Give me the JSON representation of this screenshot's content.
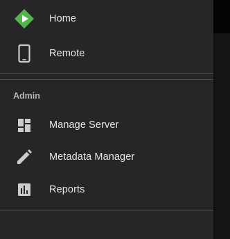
{
  "nav_top": {
    "home": {
      "label": "Home",
      "icon": "home-logo-icon",
      "accent": "#52b54b"
    },
    "remote": {
      "label": "Remote",
      "icon": "tablet-icon"
    }
  },
  "admin_section": {
    "header": "Admin",
    "items": [
      {
        "label": "Manage Server",
        "icon": "dashboard-icon"
      },
      {
        "label": "Metadata Manager",
        "icon": "pencil-icon"
      },
      {
        "label": "Reports",
        "icon": "bar-chart-icon"
      }
    ]
  },
  "colors": {
    "drawer_bg": "#262626",
    "text": "#e6e6e6",
    "section_header": "#b3b3b3",
    "divider": "#4a4a4a",
    "icon": "#cccccc"
  }
}
